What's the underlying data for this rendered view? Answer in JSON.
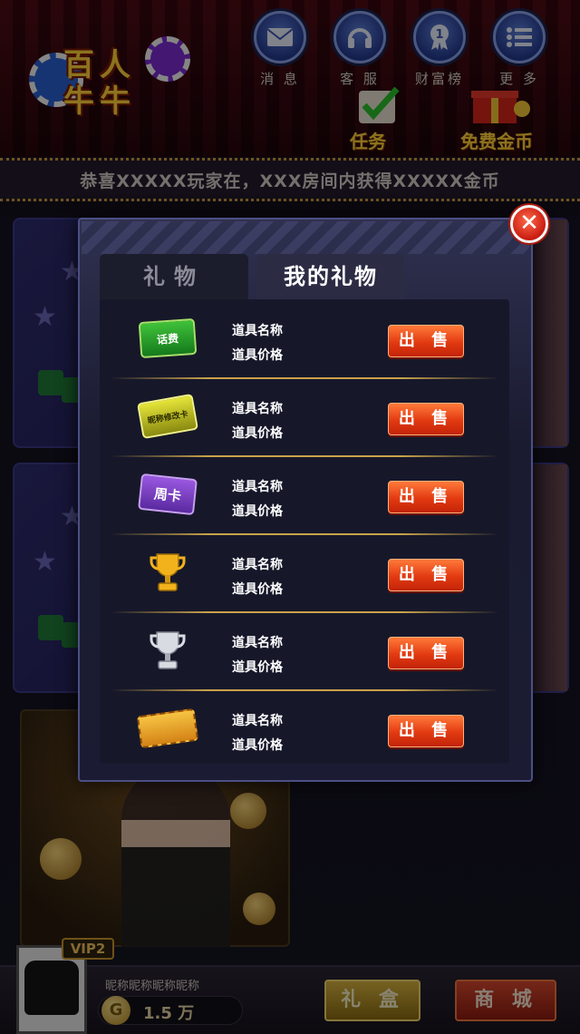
{
  "app": {
    "logo_text_line1": "百人",
    "logo_text_line2": "牛牛"
  },
  "top_nav": [
    {
      "label": "消 息",
      "icon": "mail-icon"
    },
    {
      "label": "客 服",
      "icon": "headset-icon"
    },
    {
      "label": "财富榜",
      "icon": "ranking-medal-icon"
    },
    {
      "label": "更 多",
      "icon": "menu-list-icon"
    }
  ],
  "quick_actions": {
    "task_label": "任务",
    "free_coins_label": "免费金币"
  },
  "marquee": {
    "text": "恭喜XXXXX玩家在，XXX房间内获得XXXXX金币"
  },
  "modal": {
    "tabs": [
      {
        "label": "礼物",
        "active": false
      },
      {
        "label": "我的礼物",
        "active": true
      }
    ],
    "close_icon": "close-x-icon",
    "items": [
      {
        "name": "道具名称",
        "price": "道具价格",
        "icon": "phone-credit-card-icon",
        "icon_text": "话费",
        "action": "出 售"
      },
      {
        "name": "道具名称",
        "price": "道具价格",
        "icon": "rename-card-icon",
        "icon_text": "昵称修改卡",
        "action": "出 售"
      },
      {
        "name": "道具名称",
        "price": "道具价格",
        "icon": "weekly-card-icon",
        "icon_text": "周卡",
        "action": "出 售"
      },
      {
        "name": "道具名称",
        "price": "道具价格",
        "icon": "gold-trophy-icon",
        "icon_text": "",
        "action": "出 售"
      },
      {
        "name": "道具名称",
        "price": "道具价格",
        "icon": "silver-trophy-icon",
        "icon_text": "",
        "action": "出 售"
      },
      {
        "name": "道具名称",
        "price": "道具价格",
        "icon": "ticket-icon",
        "icon_text": "",
        "action": "出 售"
      }
    ]
  },
  "player": {
    "vip": "VIP2",
    "nickname": "昵称昵称昵称昵称",
    "coins": "1.5 万",
    "coin_symbol": "G"
  },
  "bottom_buttons": {
    "gift_box": "礼 盒",
    "shop": "商 城"
  },
  "colors": {
    "sell_button": "#e23a12",
    "modal_bg": "#1a1b30",
    "gold_accent": "#c9a24a"
  }
}
